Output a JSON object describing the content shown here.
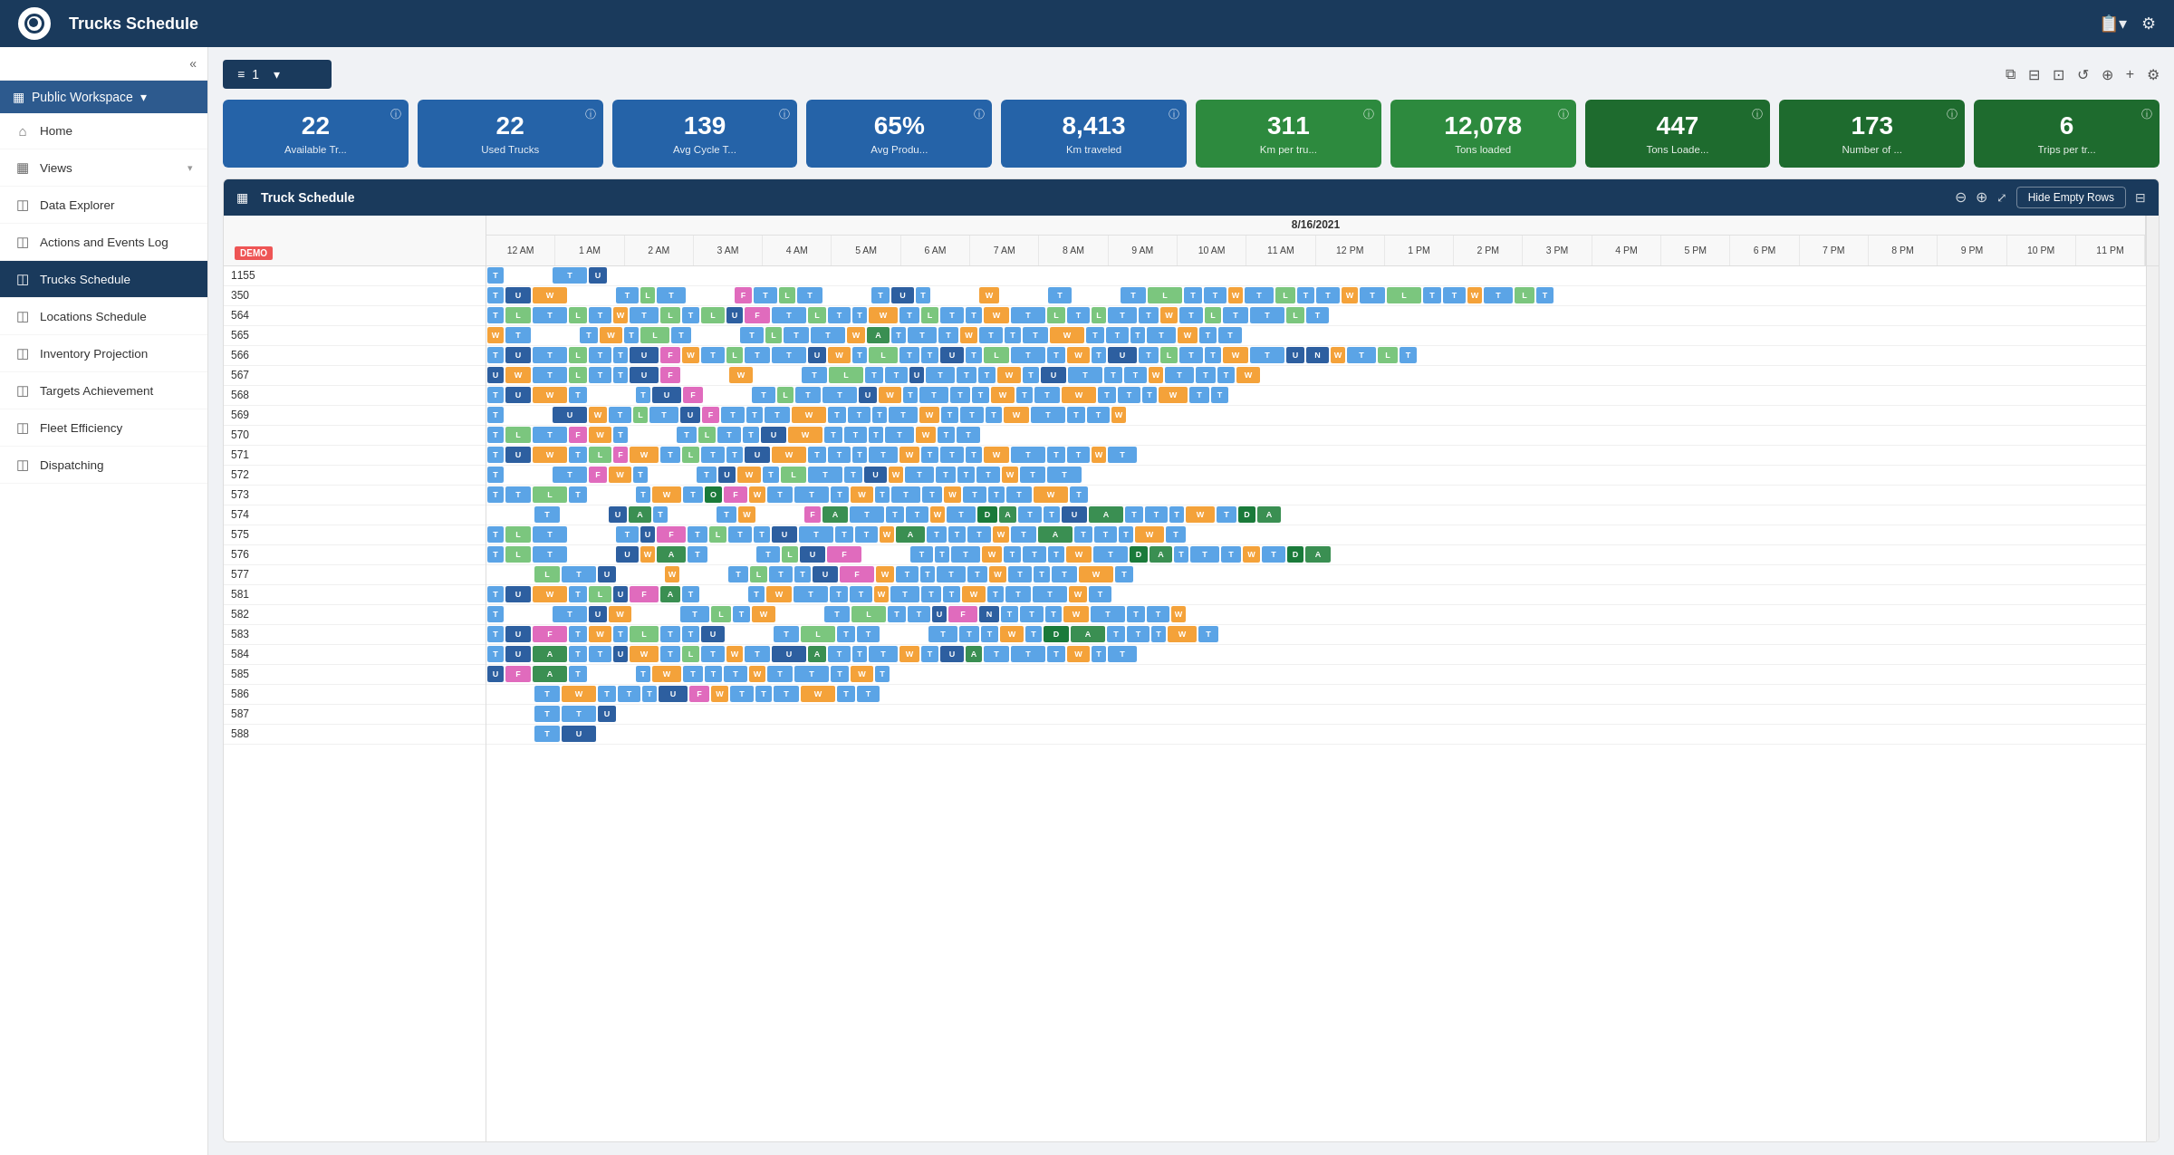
{
  "app": {
    "title": "Trucks Schedule",
    "logo_alt": "Quartix Logo"
  },
  "top_nav": {
    "clipboard_icon": "📋",
    "settings_icon": "⚙"
  },
  "sidebar": {
    "collapse_icon": "«",
    "workspace": {
      "label": "Public Workspace",
      "icon": "▦",
      "chevron": "▾"
    },
    "items": [
      {
        "id": "home",
        "label": "Home",
        "icon": "⌂",
        "active": false
      },
      {
        "id": "views",
        "label": "Views",
        "icon": "▦",
        "active": false,
        "has_chevron": true
      },
      {
        "id": "data-explorer",
        "label": "Data Explorer",
        "icon": "🔲",
        "active": false
      },
      {
        "id": "actions-events",
        "label": "Actions and Events Log",
        "icon": "🔲",
        "active": false
      },
      {
        "id": "trucks-schedule",
        "label": "Trucks Schedule",
        "icon": "🔲",
        "active": true
      },
      {
        "id": "locations-schedule",
        "label": "Locations Schedule",
        "icon": "🔲",
        "active": false
      },
      {
        "id": "inventory-projection",
        "label": "Inventory Projection",
        "icon": "🔲",
        "active": false
      },
      {
        "id": "targets-achievement",
        "label": "Targets Achievement",
        "icon": "🔲",
        "active": false
      },
      {
        "id": "fleet-efficiency",
        "label": "Fleet Efficiency",
        "icon": "🔲",
        "active": false
      },
      {
        "id": "dispatching",
        "label": "Dispatching",
        "icon": "🔲",
        "active": false
      }
    ]
  },
  "toolbar": {
    "dropdown_label": "1",
    "dropdown_icon": "≡",
    "icons": [
      "⧉",
      "⊟",
      "⊡",
      "↺",
      "⊕",
      "⚙"
    ]
  },
  "kpi_cards": [
    {
      "id": "available-trucks",
      "value": "22",
      "label": "Available Tr...",
      "color": "blue"
    },
    {
      "id": "used-trucks",
      "value": "22",
      "label": "Used Trucks",
      "color": "blue"
    },
    {
      "id": "avg-cycle",
      "value": "139",
      "label": "Avg Cycle T...",
      "color": "blue"
    },
    {
      "id": "avg-prod",
      "value": "65%",
      "label": "Avg Produ...",
      "color": "blue"
    },
    {
      "id": "km-traveled",
      "value": "8,413",
      "label": "Km traveled",
      "color": "blue"
    },
    {
      "id": "km-per-truck",
      "value": "311",
      "label": "Km per tru...",
      "color": "green"
    },
    {
      "id": "tons-loaded",
      "value": "12,078",
      "label": "Tons loaded",
      "color": "green"
    },
    {
      "id": "tons-loaded-2",
      "value": "447",
      "label": "Tons Loade...",
      "color": "dark-green"
    },
    {
      "id": "number-of",
      "value": "173",
      "label": "Number of ...",
      "color": "dark-green"
    },
    {
      "id": "trips-per-truck",
      "value": "6",
      "label": "Trips per tr...",
      "color": "dark-green"
    }
  ],
  "gantt": {
    "title": "Truck Schedule",
    "hide_empty_rows": "Hide Empty Rows",
    "demo_badge": "DEMO",
    "date": "8/16/2021",
    "times": [
      "12 AM",
      "1 AM",
      "2 AM",
      "3 AM",
      "4 AM",
      "5 AM",
      "6 AM",
      "7 AM",
      "8 AM",
      "9 AM",
      "10 AM",
      "11 AM",
      "12 PM",
      "1 PM",
      "2 PM",
      "3 PM",
      "4 PM",
      "5 PM",
      "6 PM",
      "7 PM",
      "8 PM",
      "9 PM",
      "10 PM",
      "11 PM"
    ],
    "rows": [
      {
        "id": "1155",
        "label": "1155"
      },
      {
        "id": "350",
        "label": "350"
      },
      {
        "id": "564",
        "label": "564"
      },
      {
        "id": "565",
        "label": "565"
      },
      {
        "id": "566",
        "label": "566"
      },
      {
        "id": "567",
        "label": "567"
      },
      {
        "id": "568",
        "label": "568"
      },
      {
        "id": "569",
        "label": "569"
      },
      {
        "id": "570",
        "label": "570"
      },
      {
        "id": "571",
        "label": "571"
      },
      {
        "id": "572",
        "label": "572"
      },
      {
        "id": "573",
        "label": "573"
      },
      {
        "id": "574",
        "label": "574"
      },
      {
        "id": "575",
        "label": "575"
      },
      {
        "id": "576",
        "label": "576"
      },
      {
        "id": "577",
        "label": "577"
      },
      {
        "id": "581",
        "label": "581"
      },
      {
        "id": "582",
        "label": "582"
      },
      {
        "id": "583",
        "label": "583"
      },
      {
        "id": "584",
        "label": "584"
      },
      {
        "id": "585",
        "label": "585"
      },
      {
        "id": "586",
        "label": "586"
      },
      {
        "id": "587",
        "label": "587"
      },
      {
        "id": "588",
        "label": "588"
      }
    ]
  }
}
